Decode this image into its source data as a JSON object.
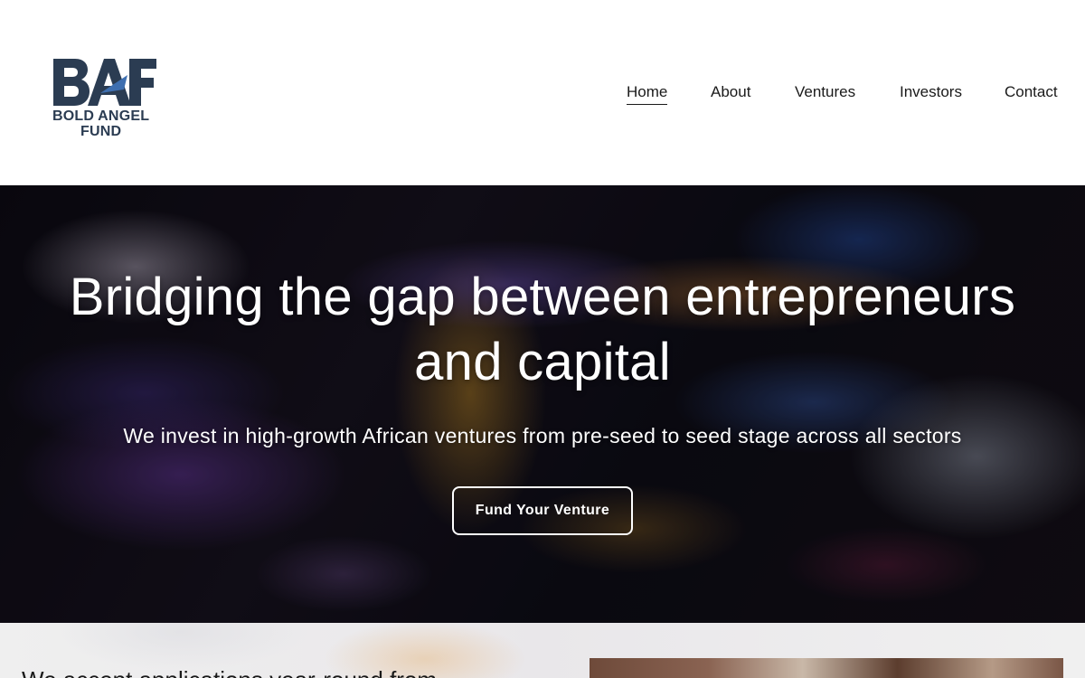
{
  "brand": {
    "logo_line1": "BOLD ANGEL",
    "logo_line2": "FUND",
    "logo_mark": "BAF",
    "color": "#2b3c52"
  },
  "nav": {
    "items": [
      {
        "label": "Home",
        "active": true
      },
      {
        "label": "About",
        "active": false
      },
      {
        "label": "Ventures",
        "active": false
      },
      {
        "label": "Investors",
        "active": false
      },
      {
        "label": "Contact",
        "active": false
      }
    ]
  },
  "hero": {
    "title_line1": "Bridging the gap between entrepreneurs",
    "title_line2": "and capital",
    "subtitle": "We invest in high-growth African ventures from pre-seed to seed stage across all sectors",
    "cta_label": "Fund Your Venture"
  },
  "below": {
    "text": "We accept applications year-round from"
  }
}
